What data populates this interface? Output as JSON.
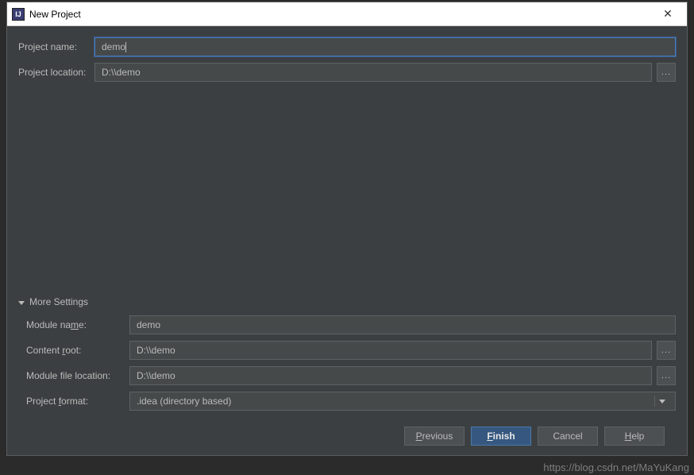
{
  "window": {
    "title": "New Project",
    "app_icon_text": "IJ"
  },
  "fields": {
    "project_name": {
      "label": "Project name:",
      "value": "demo"
    },
    "project_location": {
      "label": "Project location:",
      "value": "D:\\\\demo"
    }
  },
  "more_settings": {
    "label": "More Settings",
    "module_name": {
      "label_pre": "Module na",
      "label_mn": "m",
      "label_post": "e:",
      "value": "demo"
    },
    "content_root": {
      "label_pre": "Content ",
      "label_mn": "r",
      "label_post": "oot:",
      "value": "D:\\\\demo"
    },
    "module_file_location": {
      "label": "Module file location:",
      "value": "D:\\\\demo"
    },
    "project_format": {
      "label_pre": "Project ",
      "label_mn": "f",
      "label_post": "ormat:",
      "value": ".idea (directory based)"
    }
  },
  "buttons": {
    "previous": {
      "mn": "P",
      "rest": "revious"
    },
    "finish": {
      "mn": "F",
      "rest": "inish"
    },
    "cancel": "Cancel",
    "help": {
      "mn": "H",
      "rest": "elp"
    }
  },
  "browse_glyph": "...",
  "watermark": "https://blog.csdn.net/MaYuKang"
}
